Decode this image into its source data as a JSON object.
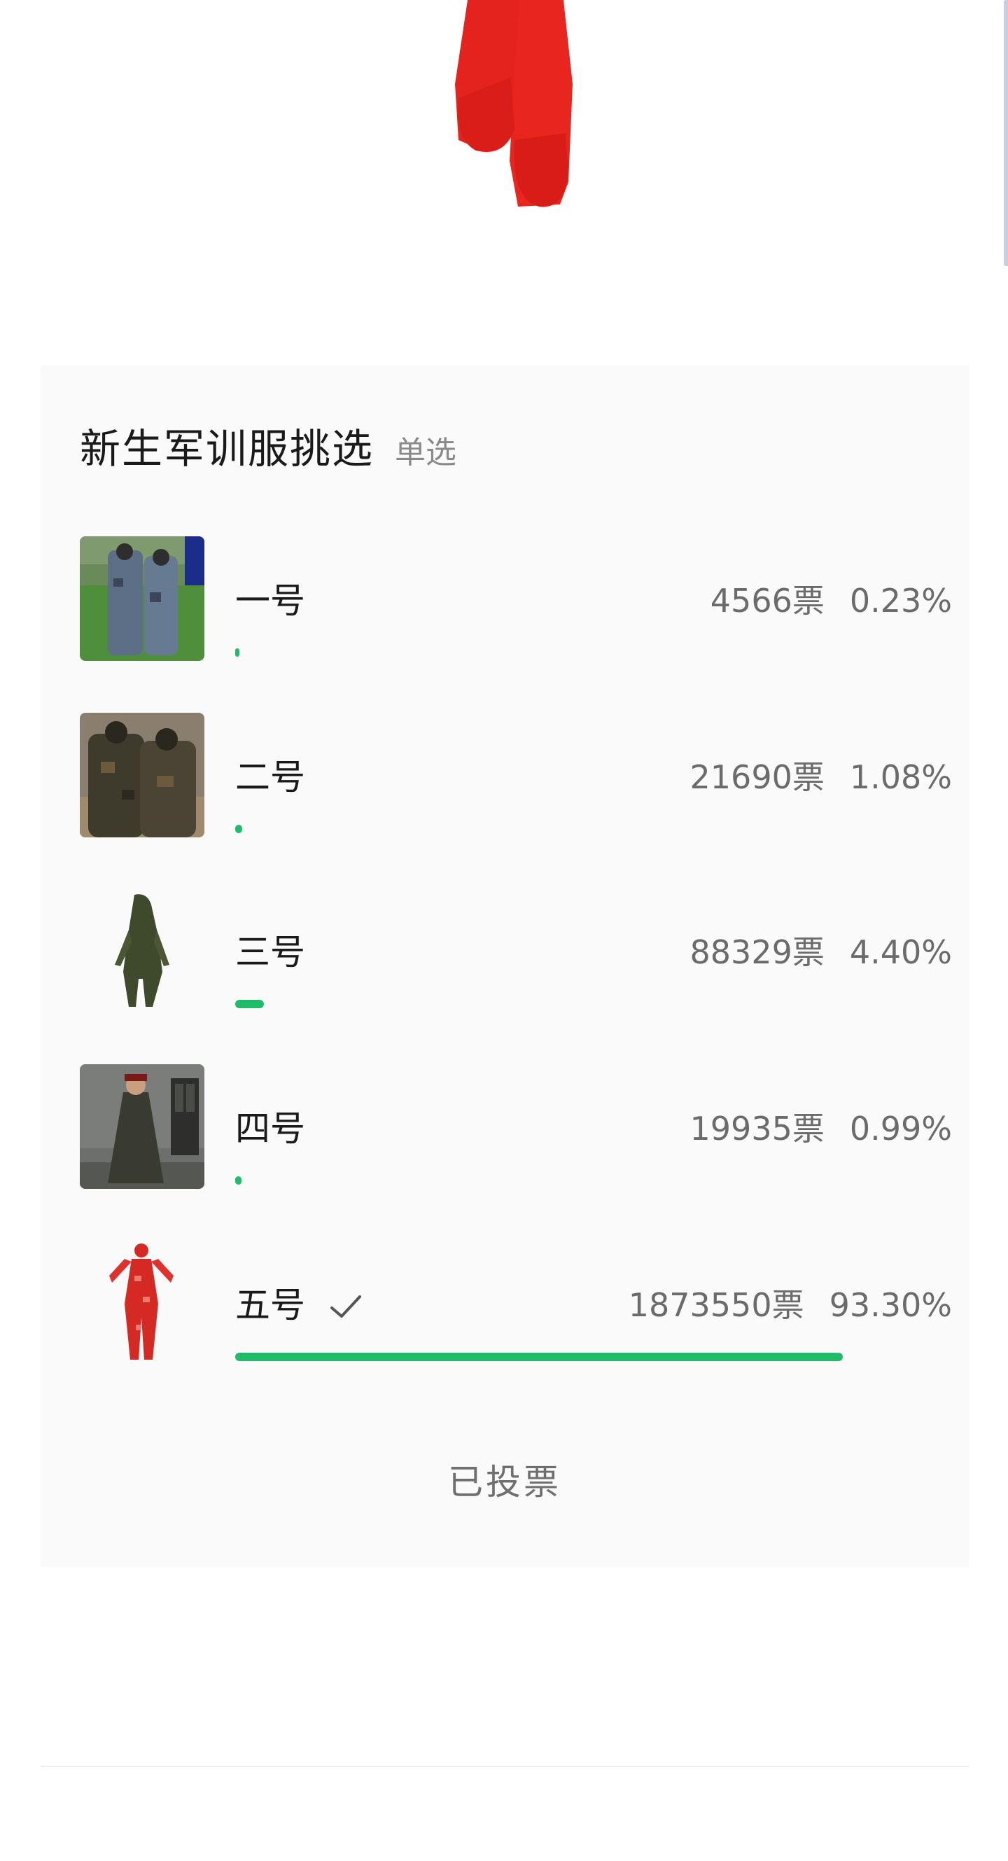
{
  "top_image": {
    "description_icon": "red-figure-legs"
  },
  "vote": {
    "title": "新生军训服挑选",
    "mode": "单选",
    "accent_color": "#1fbd6a",
    "options": [
      {
        "label": "一号",
        "votes": "4566票",
        "percent": "0.23%",
        "share": 0.0023,
        "selected": false
      },
      {
        "label": "二号",
        "votes": "21690票",
        "percent": "1.08%",
        "share": 0.0108,
        "selected": false
      },
      {
        "label": "三号",
        "votes": "88329票",
        "percent": "4.40%",
        "share": 0.044,
        "selected": false
      },
      {
        "label": "四号",
        "votes": "19935票",
        "percent": "0.99%",
        "share": 0.0099,
        "selected": false
      },
      {
        "label": "五号",
        "votes": "1873550票",
        "percent": "93.30%",
        "share": 0.933,
        "selected": true
      }
    ],
    "status_label": "已投票"
  }
}
